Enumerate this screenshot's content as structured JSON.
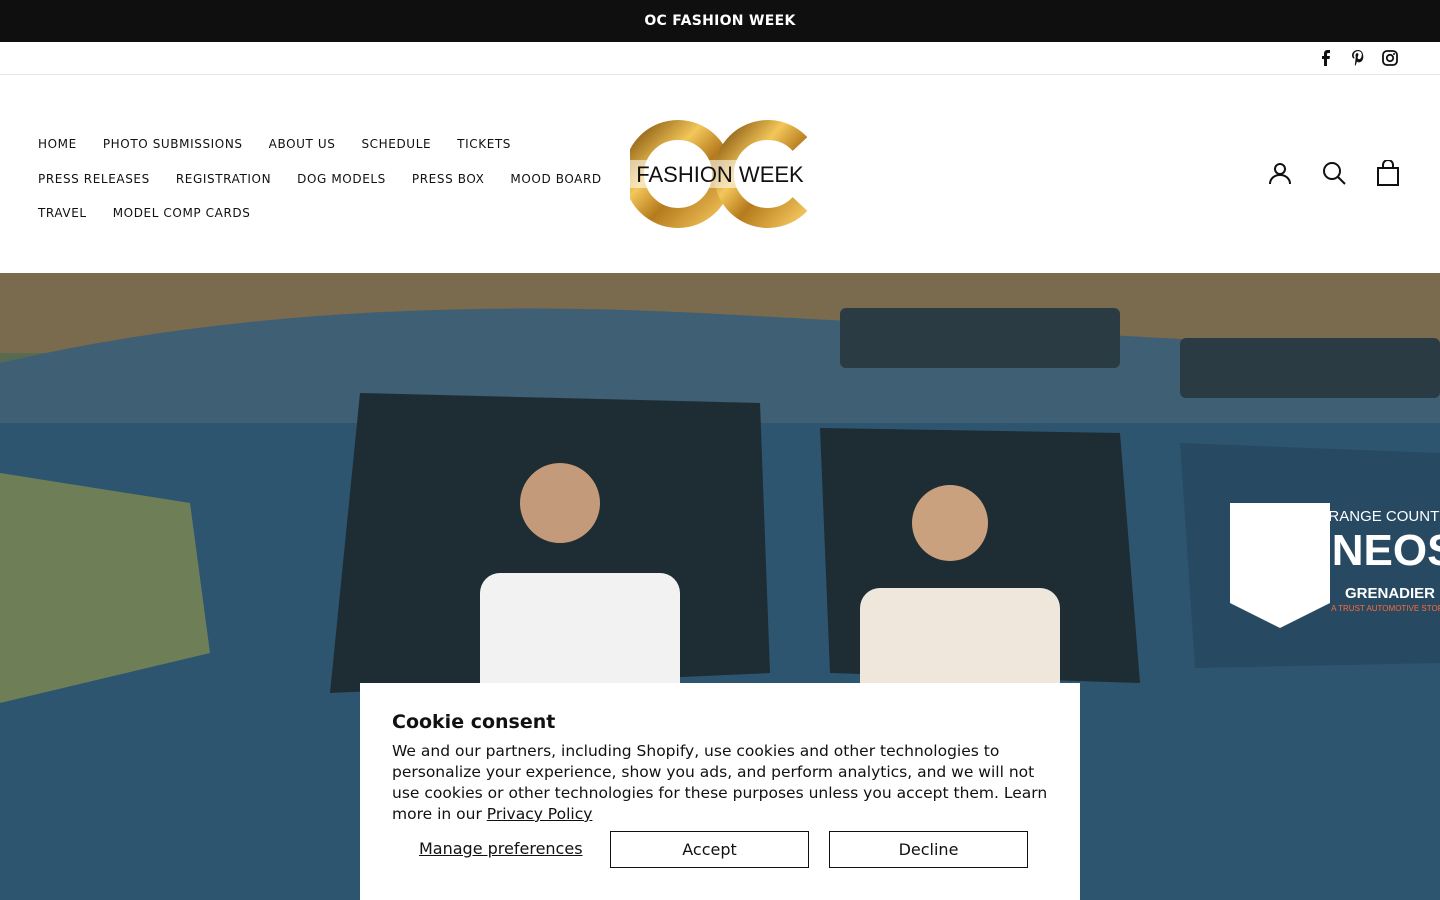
{
  "announcement": {
    "text": "OC FASHION WEEK"
  },
  "social": [
    "facebook-icon",
    "pinterest-icon",
    "instagram-icon"
  ],
  "nav": {
    "rows": [
      [
        "HOME",
        "PHOTO SUBMISSIONS",
        "ABOUT US",
        "SCHEDULE",
        "TICKETS"
      ],
      [
        "PRESS RELEASES",
        "REGISTRATION",
        "DOG MODELS",
        "PRESS BOX",
        "MOOD BOARD"
      ],
      [
        "TRAVEL",
        "MODEL COMP CARDS"
      ]
    ]
  },
  "logo": {
    "text": "FASHION WEEK",
    "mark": "OC",
    "colors": {
      "gold": "#c99a2e",
      "dark": "#111111"
    }
  },
  "header_icons": [
    "account-icon",
    "search-icon",
    "cart-icon"
  ],
  "hero": {
    "vehicle_text_1": "ORANGE COUNTY",
    "vehicle_text_2": "INEOS",
    "vehicle_text_3": "GRENADIER",
    "vehicle_text_4": "A TRUST AUTOMOTIVE STORE"
  },
  "cookie": {
    "title": "Cookie consent",
    "body": "We and our partners, including Shopify, use cookies and other technologies to personalize your experience, show you ads, and perform analytics, and we will not use cookies or other technologies for these purposes unless you accept them. Learn more in our",
    "policy_link": "Privacy Policy",
    "manage_label": "Manage preferences",
    "accept_label": "Accept",
    "decline_label": "Decline"
  }
}
